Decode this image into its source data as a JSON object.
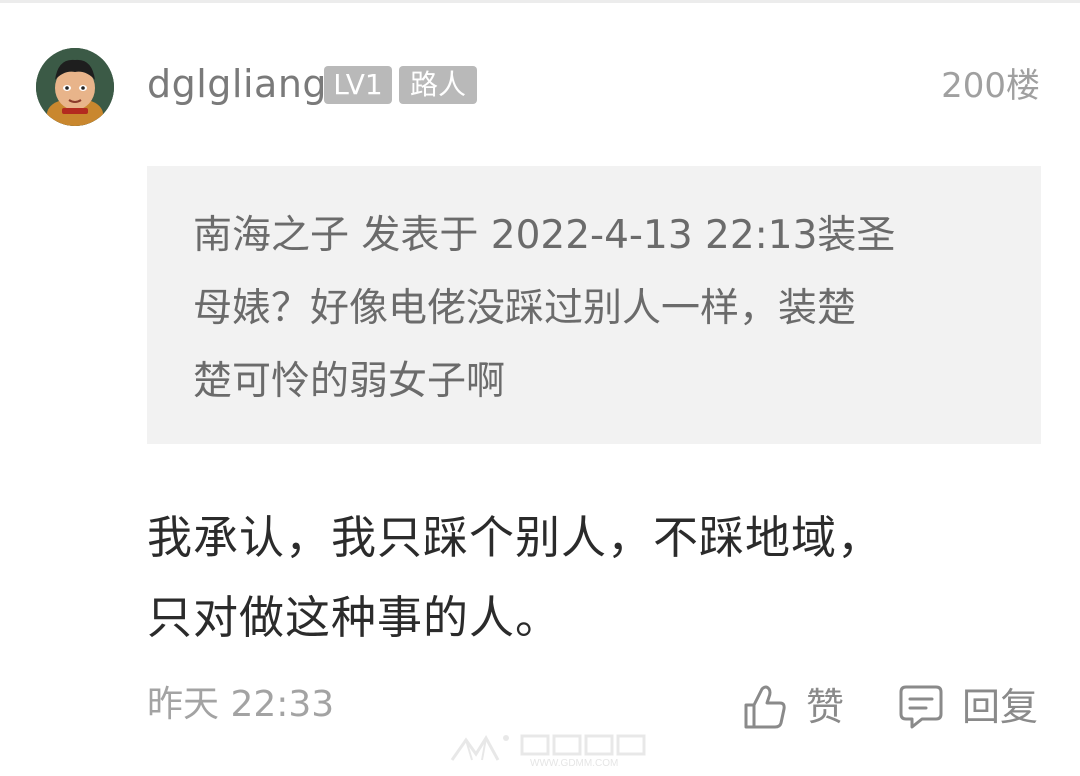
{
  "post": {
    "username": "dglgliang",
    "level_badge": "LV1",
    "role_badge": "路人",
    "floor": "200楼",
    "avatar_icon": "cartoon-character-avatar",
    "quote_lines": [
      "南海之子 发表于 2022-4-13 22:13装圣",
      "母婊？好像电佬没踩过别人一样，装楚",
      "楚可怜的弱女子啊"
    ],
    "reply_lines": [
      "我承认，我只踩个别人，不踩地域，",
      "只对做这种事的人。"
    ],
    "time": "昨天 22:33",
    "like_label": "赞",
    "reply_label": "回复",
    "like_icon": "thumbs-up-icon",
    "reply_icon": "comment-bubble-icon"
  },
  "watermark": {
    "text": "",
    "url": "WWW.GDMM.COM",
    "logo_lettering": "数码在线"
  },
  "colors": {
    "badge_bg": "#b9b9b9",
    "quote_bg": "#f2f2f2",
    "meta_text": "#a3a3a3",
    "body_text": "#2b2b2b"
  }
}
